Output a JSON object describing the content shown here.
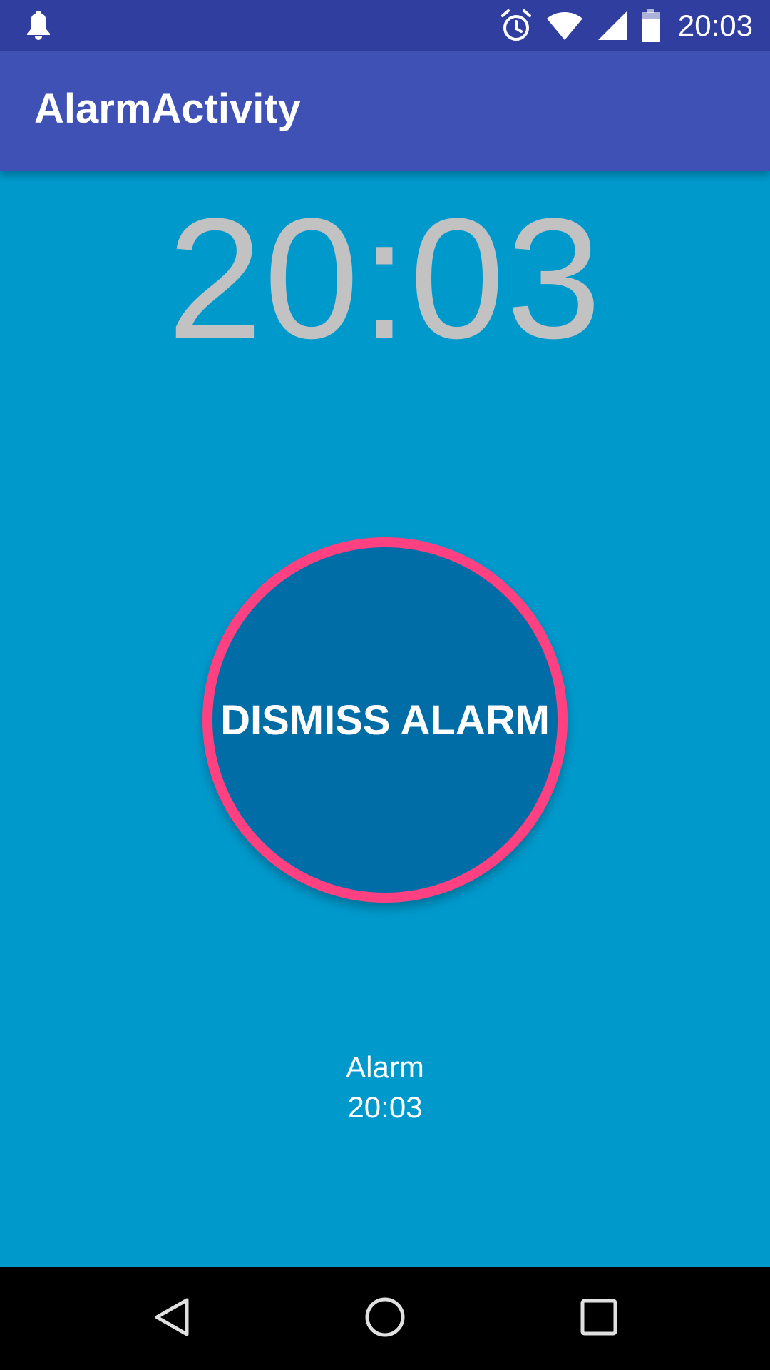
{
  "status_bar": {
    "time": "20:03",
    "icons": {
      "left": "notification-bell-icon",
      "alarm": "alarm-clock-icon",
      "wifi": "wifi-icon",
      "signal": "cell-signal-icon",
      "battery": "battery-icon"
    },
    "color": "#303f9f"
  },
  "app_bar": {
    "title": "AlarmActivity",
    "color": "#3f51b5"
  },
  "main": {
    "clock_time": "20:03",
    "dismiss_label": "DISMISS ALARM",
    "alarm_label": "Alarm",
    "alarm_time": "20:03",
    "colors": {
      "background": "#0099cc",
      "button_fill": "#006da6",
      "button_ring": "#ff4081",
      "clock_text": "#c2c2c2"
    }
  },
  "nav_bar": {
    "back": "back-icon",
    "home": "home-icon",
    "recent": "recent-apps-icon"
  }
}
